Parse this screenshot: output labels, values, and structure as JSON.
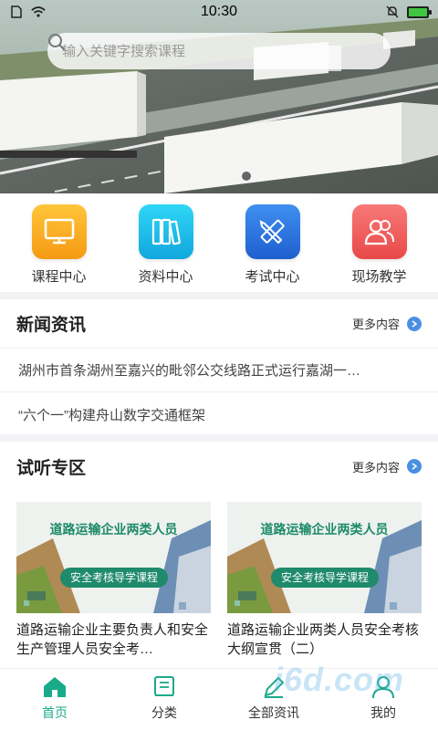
{
  "status_bar": {
    "time": "10:30"
  },
  "search": {
    "placeholder": "输入关键字搜索课程"
  },
  "quick_menu": [
    {
      "label": "课程中心",
      "icon": "monitor-icon",
      "color": "#f7a823"
    },
    {
      "label": "资料中心",
      "icon": "books-icon",
      "color": "#18b9e6"
    },
    {
      "label": "考试中心",
      "icon": "pencil-ruler-icon",
      "color": "#2f78e0"
    },
    {
      "label": "现场教学",
      "icon": "users-icon",
      "color": "#ef5a5a"
    }
  ],
  "news": {
    "title": "新闻资讯",
    "more": "更多内容",
    "items": [
      "湖州市首条湖州至嘉兴的毗邻公交线路正式运行嘉湖一…",
      "“六个一”构建舟山数字交通框架"
    ]
  },
  "trial": {
    "title": "试听专区",
    "more": "更多内容",
    "cards": [
      {
        "thumb_title": "道路运输企业两类人员",
        "thumb_badge": "安全考核导学课程",
        "title": "道路运输企业主要负责人和安全生产管理人员安全考…"
      },
      {
        "thumb_title": "道路运输企业两类人员",
        "thumb_badge": "安全考核导学课程",
        "title": "道路运输企业两类人员安全考核大纲宣贯（二）"
      }
    ]
  },
  "bottom_nav": [
    {
      "label": "首页",
      "icon": "home-icon",
      "active": true
    },
    {
      "label": "分类",
      "icon": "book-icon",
      "active": false
    },
    {
      "label": "全部资讯",
      "icon": "edit-icon",
      "active": false
    },
    {
      "label": "我的",
      "icon": "user-icon",
      "active": false
    }
  ],
  "colors": {
    "accent": "#1aaa8a",
    "more_link": "#4a90e2"
  },
  "watermark": "i6d.com"
}
